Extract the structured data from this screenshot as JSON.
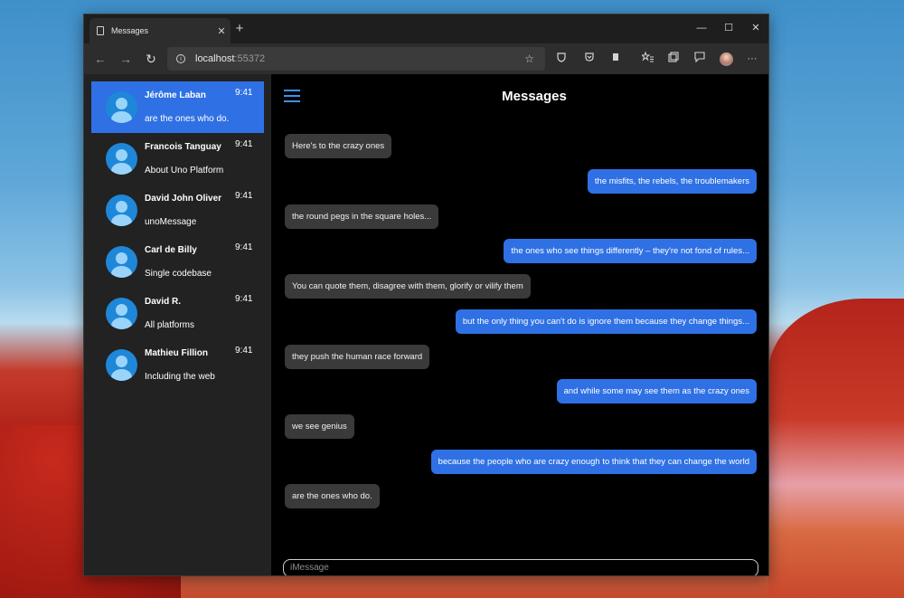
{
  "browser": {
    "tab_title": "Messages",
    "tab_close": "✕",
    "new_tab": "+",
    "address_host": "localhost",
    "address_port": ":55372",
    "window_controls": {
      "minimize": "—",
      "maximize": "☐",
      "close": "✕"
    },
    "nav": {
      "back": "←",
      "forward": "→",
      "refresh": "↻"
    },
    "icons": {
      "info": "i",
      "favorite": "☆",
      "more": "···"
    }
  },
  "app": {
    "title": "Messages",
    "input_placeholder": "iMessage",
    "conversations": [
      {
        "name": "Jérôme Laban",
        "time": "9:41",
        "preview": "are the ones who do.",
        "selected": true
      },
      {
        "name": "Francois Tanguay",
        "time": "9:41",
        "preview": "About Uno Platform",
        "selected": false
      },
      {
        "name": "David John Oliver",
        "time": "9:41",
        "preview": "unoMessage",
        "selected": false
      },
      {
        "name": "Carl de Billy",
        "time": "9:41",
        "preview": "Single codebase",
        "selected": false
      },
      {
        "name": "David R.",
        "time": "9:41",
        "preview": "All platforms",
        "selected": false
      },
      {
        "name": "Mathieu Fillion",
        "time": "9:41",
        "preview": "Including the web",
        "selected": false
      }
    ],
    "messages": [
      {
        "text": "Here's to the crazy ones",
        "direction": "in"
      },
      {
        "text": "the misfits, the rebels, the troublemakers",
        "direction": "out"
      },
      {
        "text": "the round pegs in the square holes...",
        "direction": "in"
      },
      {
        "text": "the ones who see things differently – they're not fond of rules...",
        "direction": "out"
      },
      {
        "text": "You can quote them, disagree with them, glorify or vilify them",
        "direction": "in"
      },
      {
        "text": "but the only thing you can't do is ignore them because they change things...",
        "direction": "out"
      },
      {
        "text": "they push the human race forward",
        "direction": "in"
      },
      {
        "text": "and while some may see them as the crazy ones",
        "direction": "out"
      },
      {
        "text": "we see genius",
        "direction": "in"
      },
      {
        "text": "because the people who are crazy enough to think that they can change the world",
        "direction": "out"
      },
      {
        "text": "are the ones who do.",
        "direction": "in"
      }
    ]
  },
  "colors": {
    "accent": "#2f71e4",
    "incoming_bubble": "#3a3a3a",
    "sidebar_bg": "#222222",
    "main_bg": "#000000",
    "hamburger": "#3d8ff0",
    "avatar": "#1f87d8"
  }
}
